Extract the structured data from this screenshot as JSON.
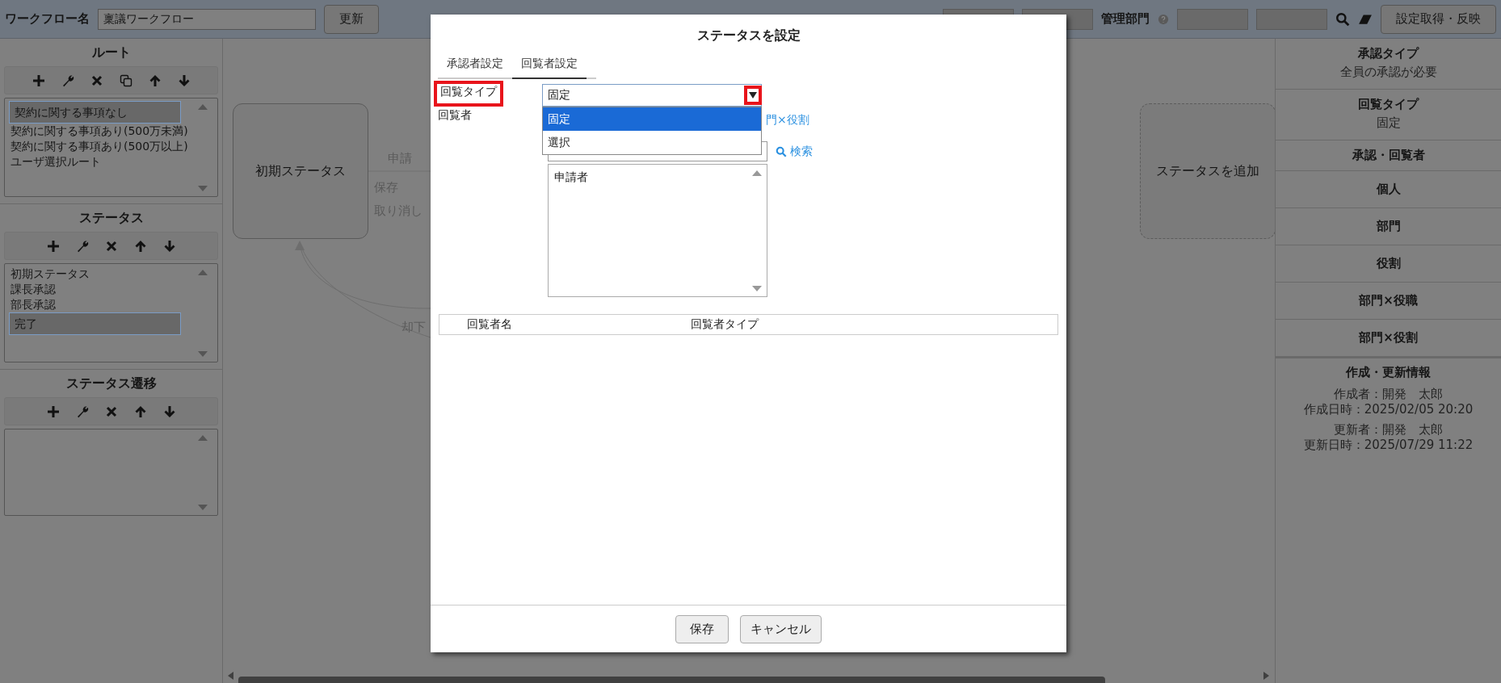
{
  "top_bar": {
    "workflow_label": "ワークフロー名",
    "workflow_name": "稟議ワークフロー",
    "update_button": "更新",
    "department_label": "管理部門",
    "apply_button": "設定取得・反映"
  },
  "left_panel": [
    {
      "title": "ルート",
      "copy_tool": true,
      "items": [
        {
          "label": "契約に関する事項なし",
          "selected": true
        },
        {
          "label": "契約に関する事項あり(500万未満)",
          "selected": false
        },
        {
          "label": "契約に関する事項あり(500万以上)",
          "selected": false
        },
        {
          "label": "ユーザ選択ルート",
          "selected": false
        }
      ]
    },
    {
      "title": "ステータス",
      "copy_tool": false,
      "items": [
        {
          "label": "初期ステータス",
          "selected": false
        },
        {
          "label": "課長承認",
          "selected": false
        },
        {
          "label": "部長承認",
          "selected": false
        },
        {
          "label": "完了",
          "selected": true
        }
      ]
    },
    {
      "title": "ステータス遷移",
      "copy_tool": false
    }
  ],
  "canvas": {
    "nodes": [
      {
        "label": "初期ステータス",
        "kind": "status"
      },
      {
        "label": "ステータスを追加",
        "kind": "add"
      }
    ],
    "edge_labels": [
      "申請",
      "保存",
      "取り消し",
      "却下"
    ]
  },
  "right_panel": {
    "sections": [
      {
        "title": "承認タイプ",
        "value": "全員の承認が必要"
      },
      {
        "title": "回覧タイプ",
        "value": "固定"
      },
      {
        "title": "承認・回覧者"
      },
      {
        "title": "個人"
      },
      {
        "title": "部門"
      },
      {
        "title": "役割"
      },
      {
        "title": "部門×役職"
      },
      {
        "title": "部門×役割"
      }
    ],
    "info": {
      "title": "作成・更新情報",
      "blocks": [
        [
          "作成者：開発　太郎",
          "作成日時：2025/02/05 20:20"
        ],
        [
          "更新者：開発　太郎",
          "更新日時：2025/07/29 11:22"
        ]
      ]
    }
  },
  "dialog": {
    "title": "ステータスを設定",
    "tabs": [
      {
        "label": "承認者設定",
        "selected": false
      },
      {
        "label": "回覧者設定",
        "selected": true
      }
    ],
    "type_label": "回覧タイプ",
    "type_value": "固定",
    "type_options": [
      {
        "label": "固定",
        "selected": true
      },
      {
        "label": "選択",
        "selected": false
      }
    ],
    "viewer_label": "回覧者",
    "viewer_link": "門×役割",
    "search_link": "検索",
    "viewer_list": [
      {
        "label": "申請者",
        "selected": false
      }
    ],
    "table": {
      "columns": [
        "回覧者名",
        "回覧者タイプ"
      ]
    },
    "buttons": [
      "保存",
      "キャンセル"
    ]
  }
}
